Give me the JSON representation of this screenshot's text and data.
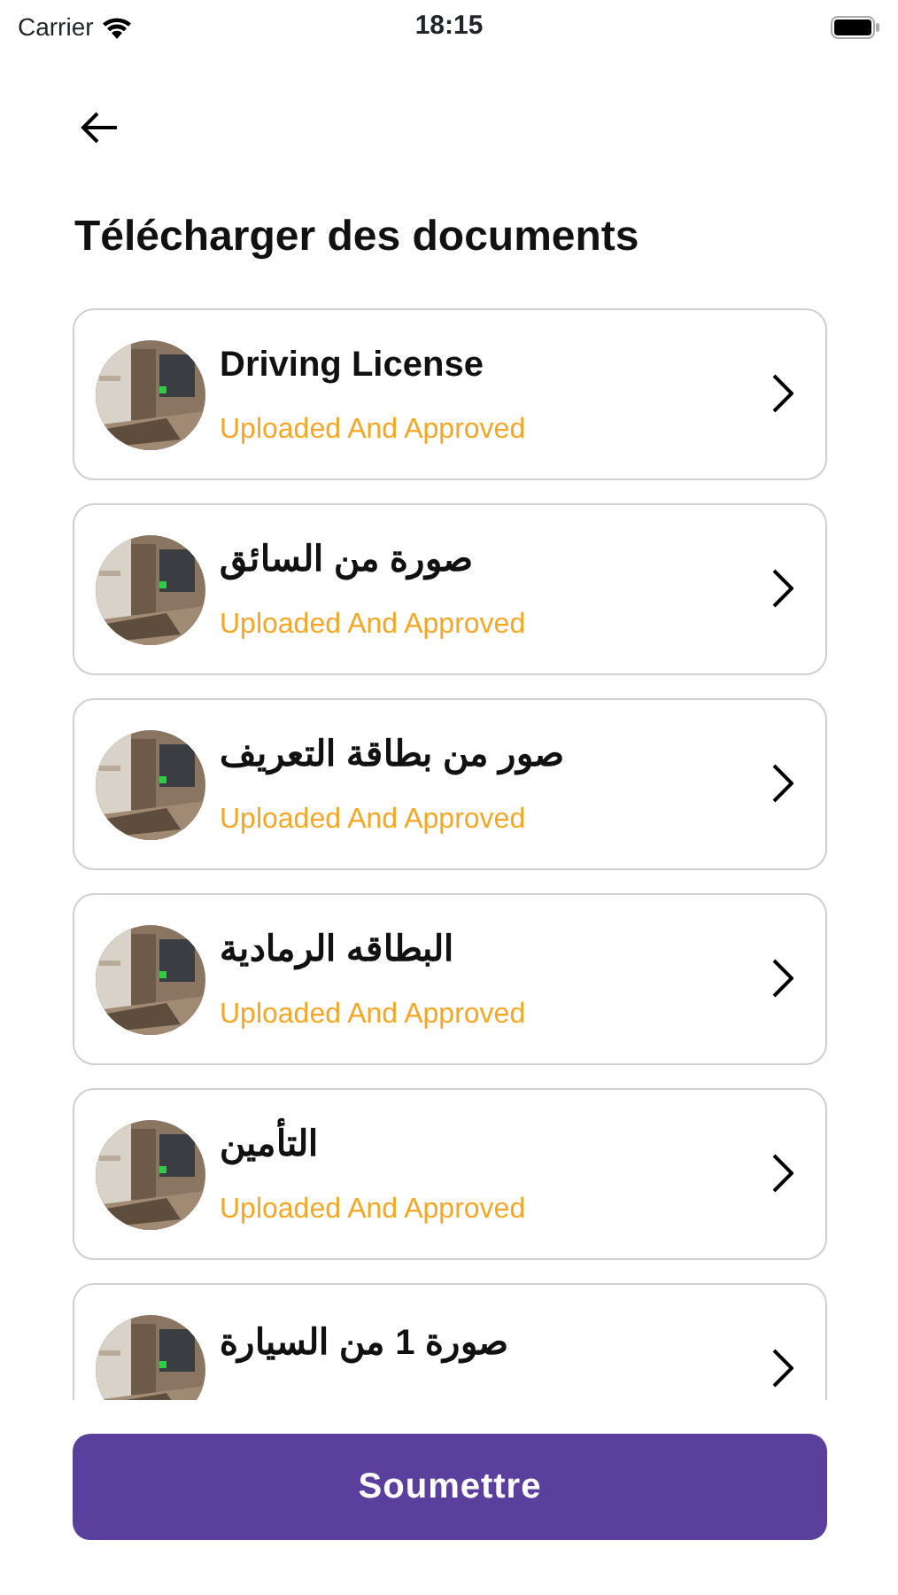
{
  "status_bar": {
    "carrier": "Carrier",
    "time": "18:15"
  },
  "title": "Télécharger des documents",
  "documents": [
    {
      "name": "Driving License",
      "status": "Uploaded And Approved"
    },
    {
      "name": "صورة من السائق",
      "status": "Uploaded And Approved"
    },
    {
      "name": "صور من بطاقة التعريف",
      "status": "Uploaded And Approved"
    },
    {
      "name": "البطاقه  الرمادية",
      "status": "Uploaded And Approved"
    },
    {
      "name": "التأمين",
      "status": "Uploaded And Approved"
    },
    {
      "name": "صورة 1 من السيارة"
    }
  ],
  "submit_button": "Soumettre"
}
